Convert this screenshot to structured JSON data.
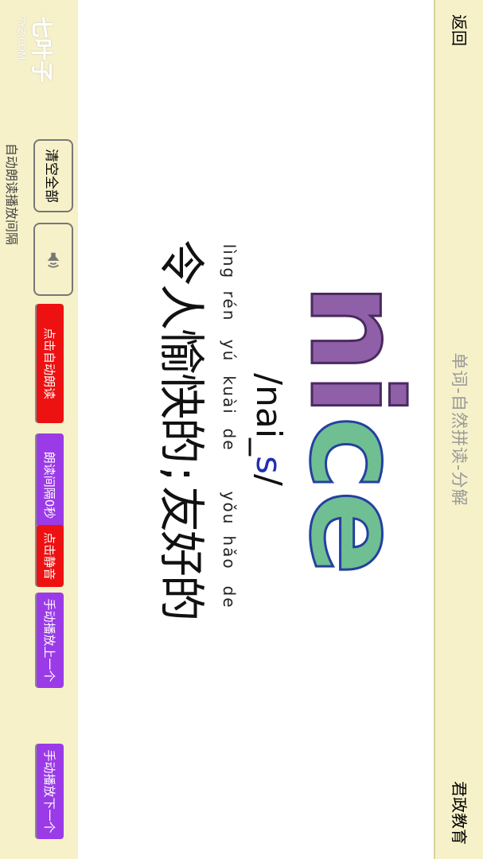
{
  "topbar": {
    "back_label": "返回",
    "title": "单词-自然拼读-分解",
    "brand": "君政教育"
  },
  "word": {
    "part1": "ni",
    "part2": "ce",
    "phonetic_prefix": "/nai_",
    "phonetic_highlight": "s",
    "phonetic_suffix": "/"
  },
  "pinyin": [
    "lìng",
    "rén",
    "yú",
    "kuài",
    "de",
    "",
    "yǒu",
    "hǎo",
    "de"
  ],
  "meaning": [
    "令",
    "人",
    "愉",
    "快",
    "的",
    ";",
    "友",
    "好",
    "的"
  ],
  "controls": {
    "clear_all": "清空全部",
    "auto_read": "点击自动朗读",
    "interval": "朗读间隔0秒",
    "mute": "点击静音",
    "prev": "手动播放上一个",
    "next": "手动播放下一个",
    "footer": "自动朗读播放间隔"
  },
  "watermark": {
    "name": "七叶子",
    "sub": "7YZ.COM"
  },
  "colors": {
    "background": "#f6f1c9",
    "red_button": "#ee1111",
    "purple_button": "#9b3be8",
    "letter_purple": "#8f5fa8",
    "letter_green": "#6fbf92"
  }
}
